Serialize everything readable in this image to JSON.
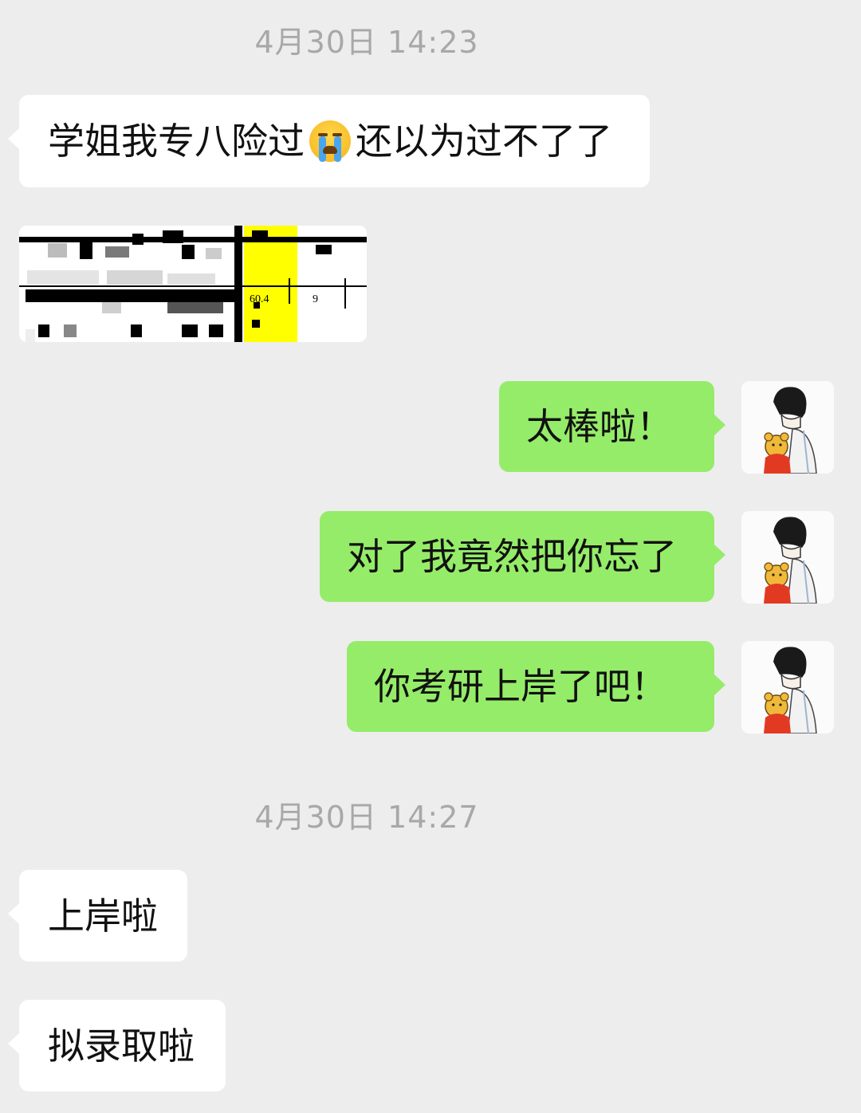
{
  "chat": {
    "timestamp_1": "4月30日 14:23",
    "timestamp_2": "4月30日 14:27",
    "msg1_part1": "学姐我专八险过",
    "msg1_emoji": "crying-face-emoji",
    "msg1_part2": "还以为过不了了",
    "screenshot": {
      "score": "60.4",
      "value": "9",
      "highlight_color": "#ffff00"
    },
    "msg2": "太棒啦！",
    "msg3": "对了我竟然把你忘了",
    "msg4": "你考研上岸了吧！",
    "msg5": "上岸啦",
    "msg6": "拟录取啦"
  },
  "colors": {
    "background": "#ededed",
    "incoming_bubble": "#ffffff",
    "outgoing_bubble": "#95ec69",
    "timestamp_text": "#a8a8a8"
  },
  "icons": {
    "avatar": "cartoon-boy-with-bear-avatar"
  }
}
